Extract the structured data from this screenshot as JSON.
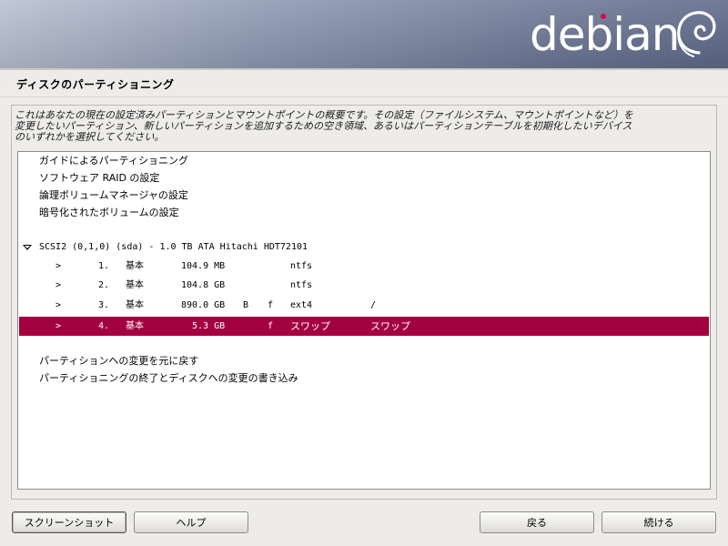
{
  "header": {
    "logo_text": "debian",
    "accent_color": "#d70751"
  },
  "page": {
    "title": "ディスクのパーティショニング",
    "description_lines": [
      "これはあなたの現在の設定済みパーティションとマウントポイントの概要です。その設定（ファイルシステム、マウントポイントなど）を",
      "変更したいパーティション、新しいパーティションを追加するための空き領域、あるいはパーティションテーブルを初期化したいデバイス",
      "のいずれかを選択してください。"
    ]
  },
  "menu_items": [
    {
      "label": "ガイドによるパーティショニング"
    },
    {
      "label": "ソフトウェア RAID の設定"
    },
    {
      "label": "論理ボリュームマネージャの設定"
    },
    {
      "label": "暗号化されたボリュームの設定"
    }
  ],
  "disk": {
    "label": "SCSI2 (0,1,0) (sda) - 1.0 TB ATA Hitachi HDT72101"
  },
  "partitions": [
    {
      "arrow": ">",
      "number": "1.",
      "type": "基本",
      "size": "104.9 MB",
      "bootable": "",
      "format": "",
      "filesystem": "ntfs",
      "mount": ""
    },
    {
      "arrow": ">",
      "number": "2.",
      "type": "基本",
      "size": "104.8 GB",
      "bootable": "",
      "format": "",
      "filesystem": "ntfs",
      "mount": ""
    },
    {
      "arrow": ">",
      "number": "3.",
      "type": "基本",
      "size": "890.0 GB",
      "bootable": "B",
      "format": "f",
      "filesystem": "ext4",
      "mount": "/"
    },
    {
      "arrow": ">",
      "number": "4.",
      "type": "基本",
      "size": "5.3 GB",
      "bootable": "",
      "format": "f",
      "filesystem": "スワップ",
      "mount": "スワップ"
    }
  ],
  "selected_partition": "4.",
  "selection_color": "#a3003f",
  "actions": [
    {
      "label": "パーティションへの変更を元に戻す"
    },
    {
      "label": "パーティショニングの終了とディスクへの変更の書き込み"
    }
  ],
  "buttons": {
    "screenshot": "スクリーンショット",
    "help": "ヘルプ",
    "back": "戻る",
    "continue": "続ける"
  }
}
